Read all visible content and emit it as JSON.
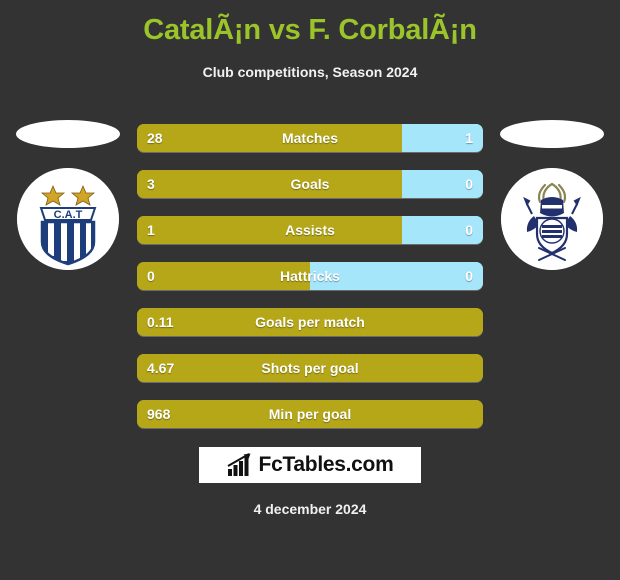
{
  "header": {
    "title": "CatalÃ¡n vs F. CorbalÃ¡n",
    "subtitle": "Club competitions, Season 2024"
  },
  "teams": {
    "home": {
      "crest_name": "club-atletico-talleres-crest",
      "crest_text": "C.A.T"
    },
    "away": {
      "crest_name": "gimnasia-la-plata-crest",
      "crest_text": ""
    }
  },
  "colors": {
    "background": "#333333",
    "title": "#9ac42a",
    "home_bar": "#b5a718",
    "away_bar": "#a6e6fb",
    "text": "#ffffff"
  },
  "chart_data": {
    "type": "bar",
    "title": "CatalÃ¡n vs F. CorbalÃ¡n",
    "subtitle": "Club competitions, Season 2024",
    "orientation": "horizontal-diverging",
    "legend_position": "none",
    "grid": false,
    "series": [
      {
        "name": "CatalÃ¡n",
        "color": "#b5a718"
      },
      {
        "name": "F. CorbalÃ¡n",
        "color": "#a6e6fb"
      }
    ],
    "categories": [
      "Matches",
      "Goals",
      "Assists",
      "Hattricks",
      "Goals per match",
      "Shots per goal",
      "Min per goal"
    ],
    "rows": [
      {
        "label": "Matches",
        "home": "28",
        "away": "1",
        "home_pct": 76.5,
        "away_pct": 23.5,
        "split": true
      },
      {
        "label": "Goals",
        "home": "3",
        "away": "0",
        "home_pct": 76.5,
        "away_pct": 23.5,
        "split": true
      },
      {
        "label": "Assists",
        "home": "1",
        "away": "0",
        "home_pct": 76.5,
        "away_pct": 23.5,
        "split": true
      },
      {
        "label": "Hattricks",
        "home": "0",
        "away": "0",
        "home_pct": 50.0,
        "away_pct": 50.0,
        "split": true
      },
      {
        "label": "Goals per match",
        "home": "0.11",
        "away": "",
        "home_pct": 100,
        "away_pct": 0,
        "split": false
      },
      {
        "label": "Shots per goal",
        "home": "4.67",
        "away": "",
        "home_pct": 100,
        "away_pct": 0,
        "split": false
      },
      {
        "label": "Min per goal",
        "home": "968",
        "away": "",
        "home_pct": 100,
        "away_pct": 0,
        "split": false
      }
    ]
  },
  "footer": {
    "logo_text": "FcTables.com",
    "logo_icon": "bar-chart-arrow-icon",
    "date": "4 december 2024"
  }
}
